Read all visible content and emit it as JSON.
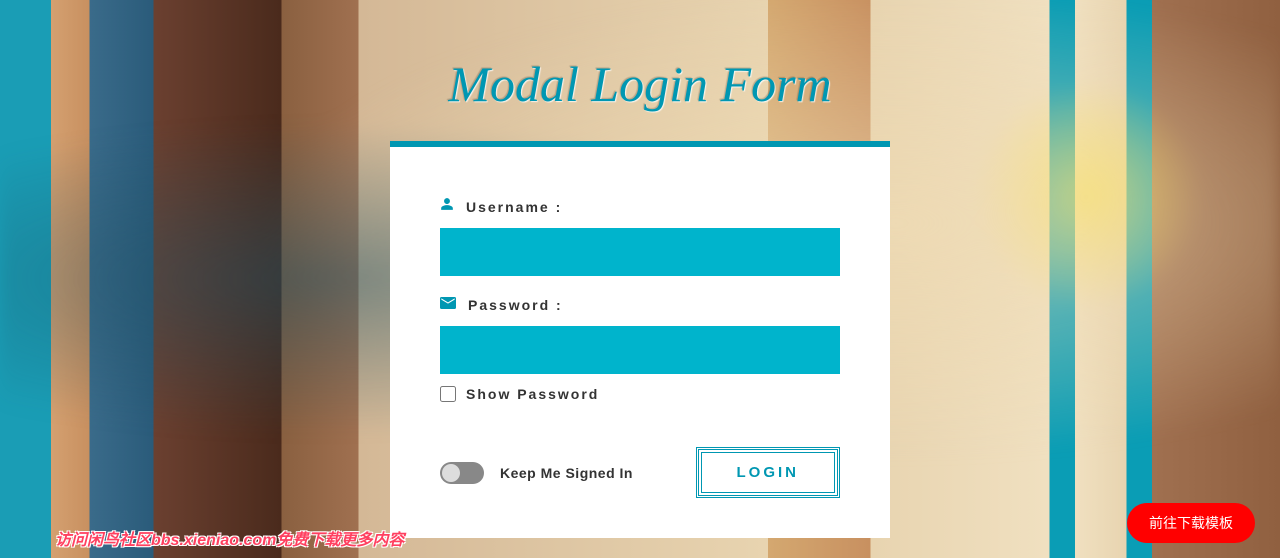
{
  "title": "Modal Login Form",
  "form": {
    "username_label": "Username :",
    "username_value": "",
    "password_label": "Password :",
    "password_value": "",
    "show_password_label": "Show Password",
    "keep_signed_label": "Keep Me Signed In",
    "login_button": "LOGIN"
  },
  "watermark": "访问闲鸟社区bbs.xieniao.com免费下载更多内容",
  "download_button": "前往下载模板"
}
